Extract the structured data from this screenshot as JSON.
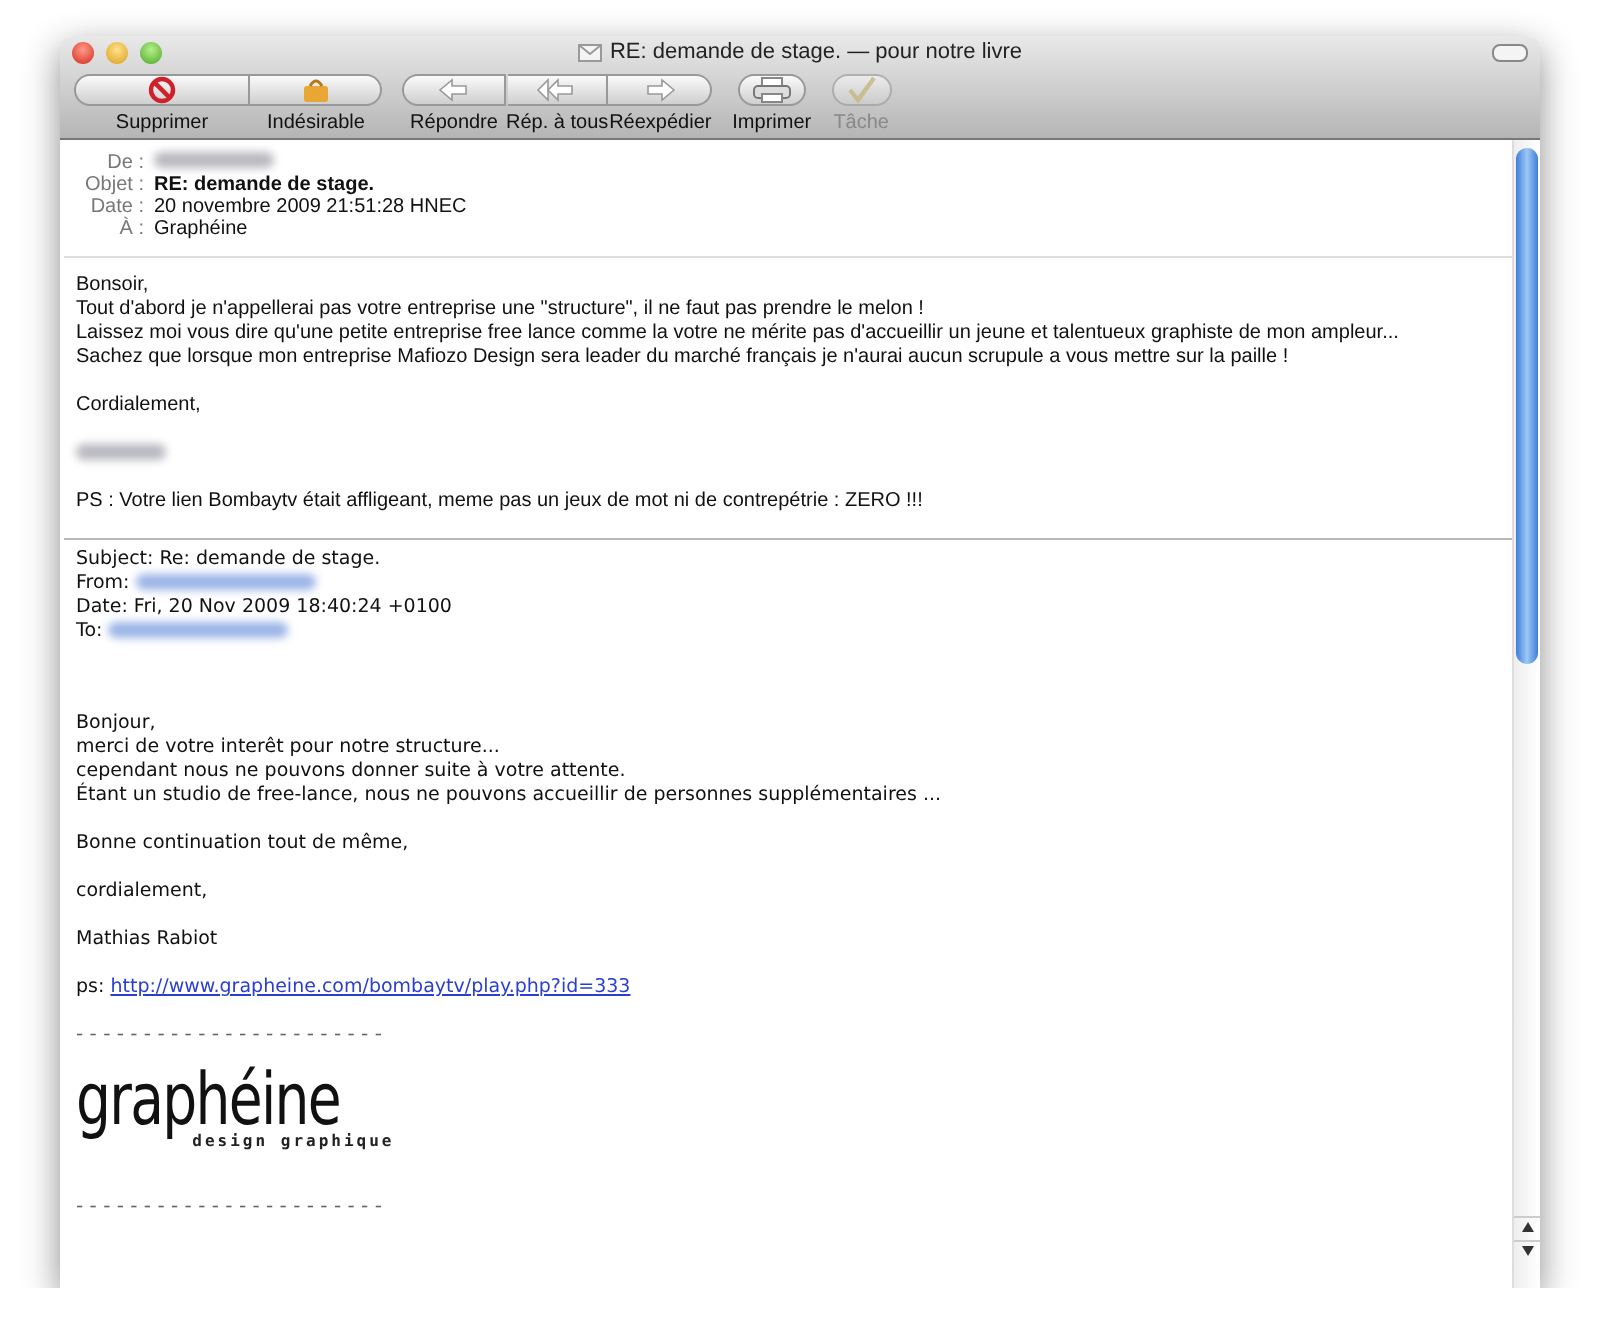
{
  "window": {
    "title": "RE: demande de stage. — pour notre livre"
  },
  "toolbar": [
    {
      "buttons": [
        {
          "label": "Supprimer",
          "kind": "delete",
          "disabled": false
        },
        {
          "label": "Indésirable",
          "kind": "junk",
          "disabled": false
        }
      ]
    },
    {
      "buttons": [
        {
          "label": "Répondre",
          "kind": "reply",
          "disabled": false
        },
        {
          "label": "Rép. à tous",
          "kind": "reply_all",
          "disabled": false
        },
        {
          "label": "Réexpédier",
          "kind": "forward",
          "disabled": false
        }
      ]
    },
    {
      "buttons": [
        {
          "label": "Imprimer",
          "kind": "print",
          "disabled": false
        }
      ]
    },
    {
      "buttons": [
        {
          "label": "Tâche",
          "kind": "task",
          "disabled": true
        }
      ]
    }
  ],
  "header": [
    {
      "label": "De :",
      "kind": "redacted"
    },
    {
      "label": "Objet :",
      "kind": "bold",
      "value": "RE: demande de stage."
    },
    {
      "label": "Date :",
      "kind": "plain",
      "value": "20 novembre 2009 21:51:28 HNEC"
    },
    {
      "label": "À :",
      "kind": "plain",
      "value": "Graphéine"
    }
  ],
  "message": [
    [
      {
        "kind": "text",
        "text": "Bonsoir,"
      },
      {
        "kind": "text",
        "text": "Tout d'abord je n'appellerai pas votre entreprise une \"structure\", il ne faut pas prendre le melon !"
      },
      {
        "kind": "text",
        "text": "Laissez moi vous dire qu'une petite entreprise free lance comme la votre ne mérite pas d'accueillir un jeune et talentueux graphiste de mon ampleur..."
      },
      {
        "kind": "text",
        "text": "Sachez que lorsque mon entreprise Mafiozo Design sera leader du marché français je n'aurai aucun scrupule a vous mettre sur la paille !"
      }
    ],
    [
      {
        "kind": "text",
        "text": "Cordialement,"
      }
    ],
    [
      {
        "kind": "redacted"
      }
    ],
    [
      {
        "kind": "text",
        "text": "PS : Votre lien Bombaytv était affligeant, meme pas un jeux de mot ni de contrepétrie : ZERO !!!"
      }
    ]
  ],
  "quoted_header": [
    {
      "kind": "text",
      "text": "Subject: Re: demande de stage."
    },
    {
      "kind": "redacted",
      "text": "From:"
    },
    {
      "kind": "text",
      "text": "Date: Fri, 20 Nov 2009 18:40:24 +0100"
    },
    {
      "kind": "redacted",
      "text": "To:"
    }
  ],
  "quoted_body": [
    [
      {
        "kind": "text",
        "text": "Bonjour,"
      },
      {
        "kind": "text",
        "text": "merci de votre interêt pour notre structure..."
      },
      {
        "kind": "text",
        "text": "cependant nous ne pouvons donner suite à votre attente."
      },
      {
        "kind": "text",
        "text": "Étant un studio de free-lance, nous ne pouvons accueillir de personnes  supplémentaires ..."
      }
    ],
    [
      {
        "kind": "text",
        "text": "Bonne continuation tout de même,"
      }
    ],
    [
      {
        "kind": "text",
        "text": "cordialement,"
      }
    ],
    [
      {
        "kind": "text",
        "text": "Mathias Rabiot"
      }
    ],
    [
      {
        "kind": "link",
        "text": "ps:",
        "link": "http://www.grapheine.com/bombaytv/play.php?id=333"
      }
    ]
  ],
  "signature": {
    "divider_top": "- - - - - - - - - - - - - - - - - - - - - - -",
    "logo_name": "graphéine",
    "logo_tagline": "design graphique",
    "divider_bottom": "- - - - - - - - - - - - - - - - - - - - - - -"
  }
}
